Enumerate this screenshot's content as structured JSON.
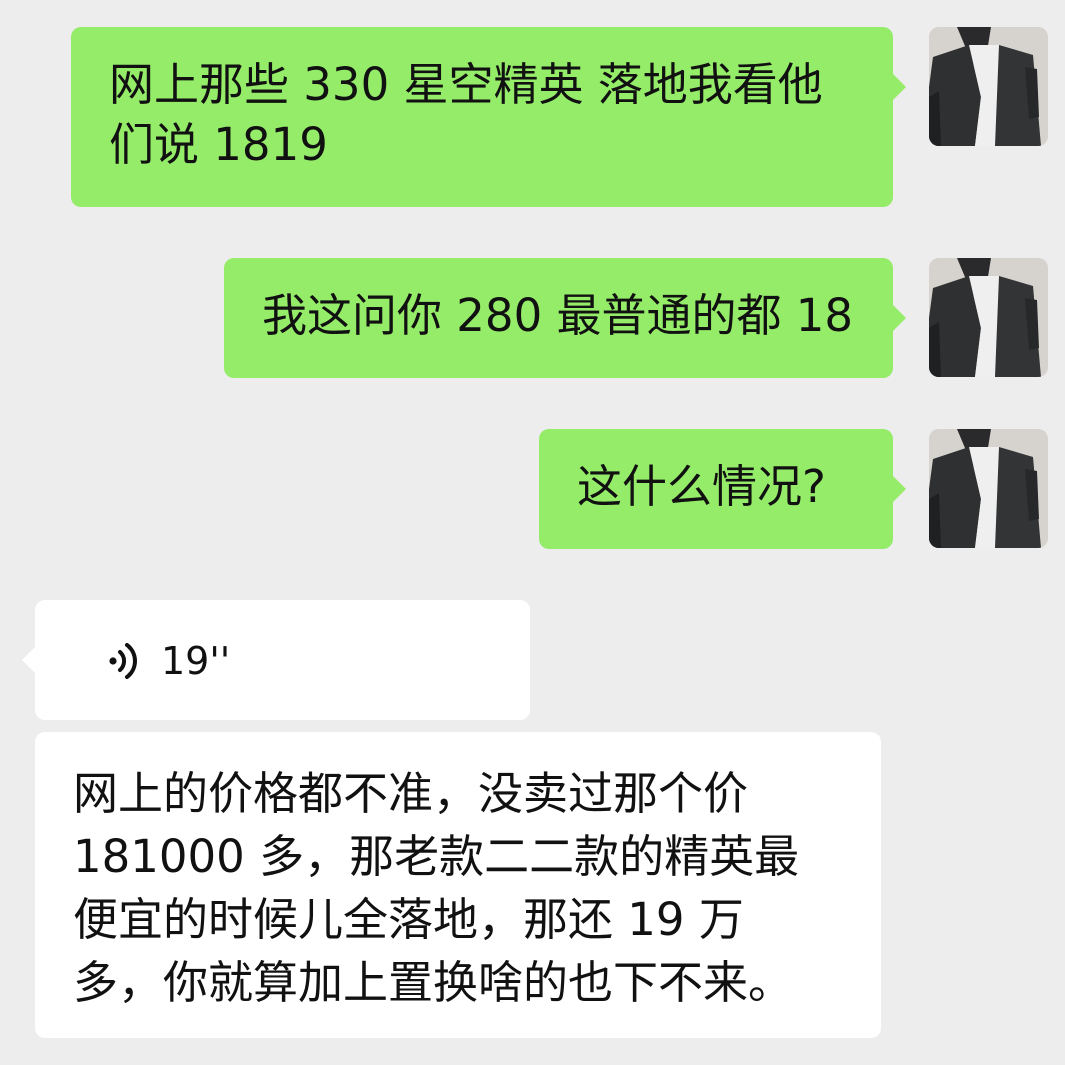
{
  "chat": {
    "messages": [
      {
        "sender": "me",
        "text": "网上那些 330 星空精英 落地我看他\n们说 1819"
      },
      {
        "sender": "me",
        "text": "我这问你 280 最普通的都 18"
      },
      {
        "sender": "me",
        "text": "这什么情况?"
      },
      {
        "sender": "other",
        "type": "voice",
        "duration": "19''",
        "icon": "voice-wave-icon"
      },
      {
        "sender": "other",
        "type": "transcript",
        "text": "网上的价格都不准，没卖过那个价\n181000 多，那老款二二款的精英最\n便宜的时候儿全落地，那还 19 万\n多，你就算加上置换啥的也下不来。"
      }
    ]
  },
  "colors": {
    "background": "#ededed",
    "outgoing_bubble": "#95ec69",
    "incoming_bubble": "#ffffff",
    "text": "#111111"
  }
}
